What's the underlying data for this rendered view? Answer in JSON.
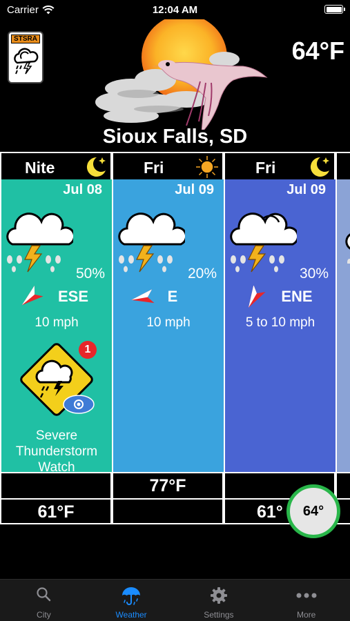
{
  "status_bar": {
    "carrier": "Carrier",
    "time": "12:04 AM"
  },
  "header": {
    "alert_badge_label": "STSRA",
    "current_temp": "64°F",
    "city": "Sioux Falls, SD"
  },
  "forecast": [
    {
      "day": "Nite",
      "day_icon": "moon-star-icon",
      "date": "Jul 08",
      "pop": "50%",
      "wind_dir": "ESE",
      "wind_speed": "10 mph",
      "high": "",
      "low": "61°F",
      "bg": "#20c0a4"
    },
    {
      "day": "Fri",
      "day_icon": "sun-icon",
      "date": "Jul 09",
      "pop": "20%",
      "wind_dir": "E",
      "wind_speed": "10 mph",
      "high": "77°F",
      "low": "",
      "bg": "#3aa3de"
    },
    {
      "day": "Fri",
      "day_icon": "moon-star-icon",
      "date": "Jul 09",
      "pop": "30%",
      "wind_dir": "ENE",
      "wind_speed": "5 to 10 mph",
      "high": "",
      "low": "61°",
      "bg": "#4a64d2"
    }
  ],
  "alert": {
    "count": "1",
    "line1": "Severe",
    "line2": "Thunderstorm",
    "line3": "Watch",
    "icon": "thunderstorm-warning-sign-icon"
  },
  "temp_bubble": "64°",
  "tabs": [
    {
      "label": "City",
      "icon": "search-icon",
      "active": false
    },
    {
      "label": "Weather",
      "icon": "umbrella-icon",
      "active": true
    },
    {
      "label": "Settings",
      "icon": "gear-icon",
      "active": false
    },
    {
      "label": "More",
      "icon": "more-dots-icon",
      "active": false
    }
  ],
  "colors": {
    "accent": "#1a8cff",
    "alert_red": "#e8262a",
    "bubble_ring": "#29b64a",
    "sign_yellow": "#f3cf1b"
  }
}
